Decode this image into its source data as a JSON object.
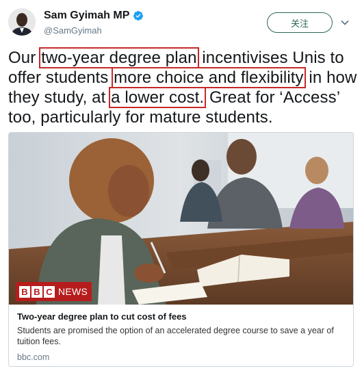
{
  "tweet": {
    "display_name": "Sam Gyimah MP",
    "handle": "@SamGyimah",
    "follow_label": "关注",
    "text_segments": [
      {
        "text": "Our ",
        "highlight": false
      },
      {
        "text": "two-year degree plan",
        "highlight": true
      },
      {
        "text": " incentivises Unis to offer students ",
        "highlight": false
      },
      {
        "text": "more choice and flexibility",
        "highlight": true
      },
      {
        "text": " in how they study, at ",
        "highlight": false
      },
      {
        "text": "a lower cost.",
        "highlight": true
      },
      {
        "text": " Great for ‘Access’ too, particularly for mature students.",
        "highlight": false
      }
    ]
  },
  "card": {
    "logo_boxes": [
      "B",
      "B",
      "C"
    ],
    "logo_word": "NEWS",
    "title": "Two-year degree plan to cut cost of fees",
    "description": "Students are promised the option of an accelerated degree course to save a year of tuition fees.",
    "domain": "bbc.com"
  },
  "colors": {
    "highlight_border": "#c62828",
    "verified": "#1da1f2",
    "follow_green": "#2d6a4f",
    "bbc_red": "#b71c1c"
  },
  "icons": {
    "verified": "verified-badge-icon",
    "chevron": "chevron-down-icon"
  }
}
